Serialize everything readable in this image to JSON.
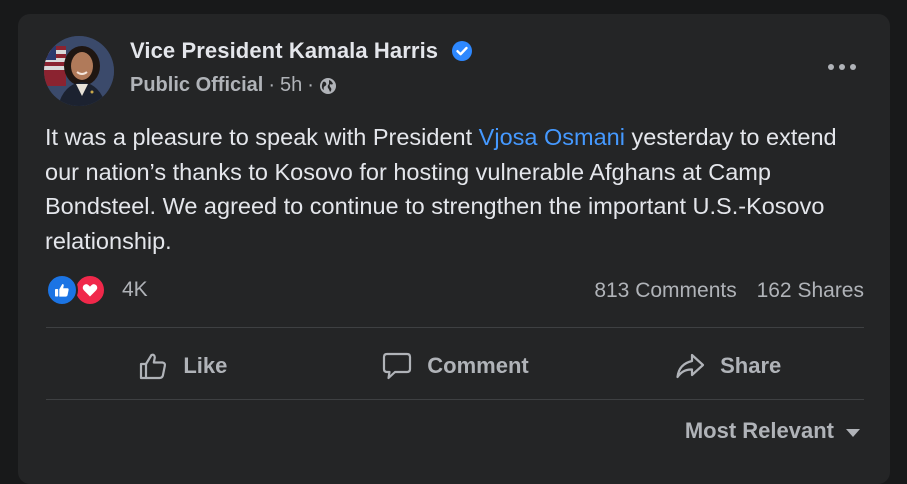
{
  "post": {
    "author": {
      "name": "Vice President Kamala Harris",
      "verified_icon": "verified-badge-icon",
      "role": "Public Official",
      "separator": "·",
      "time": "5h",
      "audience_icon": "globe-icon"
    },
    "more_icon": "more-options-icon",
    "text": {
      "before": "It was a pleasure to speak with President ",
      "mention": "Vjosa Osmani",
      "after": " yesterday to extend our nation’s thanks to Kosovo for hosting vulnerable Afghans at Camp Bondsteel. We agreed to continue to strengthen the important U.S.-Kosovo relationship."
    },
    "reactions": {
      "icons": [
        "like-reaction-icon",
        "love-reaction-icon"
      ],
      "count": "4K"
    },
    "stats": {
      "comments": "813 Comments",
      "shares": "162 Shares"
    },
    "actions": {
      "like_label": "Like",
      "comment_label": "Comment",
      "share_label": "Share"
    },
    "comments_sort": {
      "label": "Most Relevant"
    }
  },
  "colors": {
    "background": "#18191a",
    "card": "#242526",
    "primary_text": "#e4e6eb",
    "secondary_text": "#b0b3b8",
    "link": "#4599ff",
    "verified": "#2d88ff",
    "like": "#1b74e4",
    "love": "#f0284a"
  }
}
